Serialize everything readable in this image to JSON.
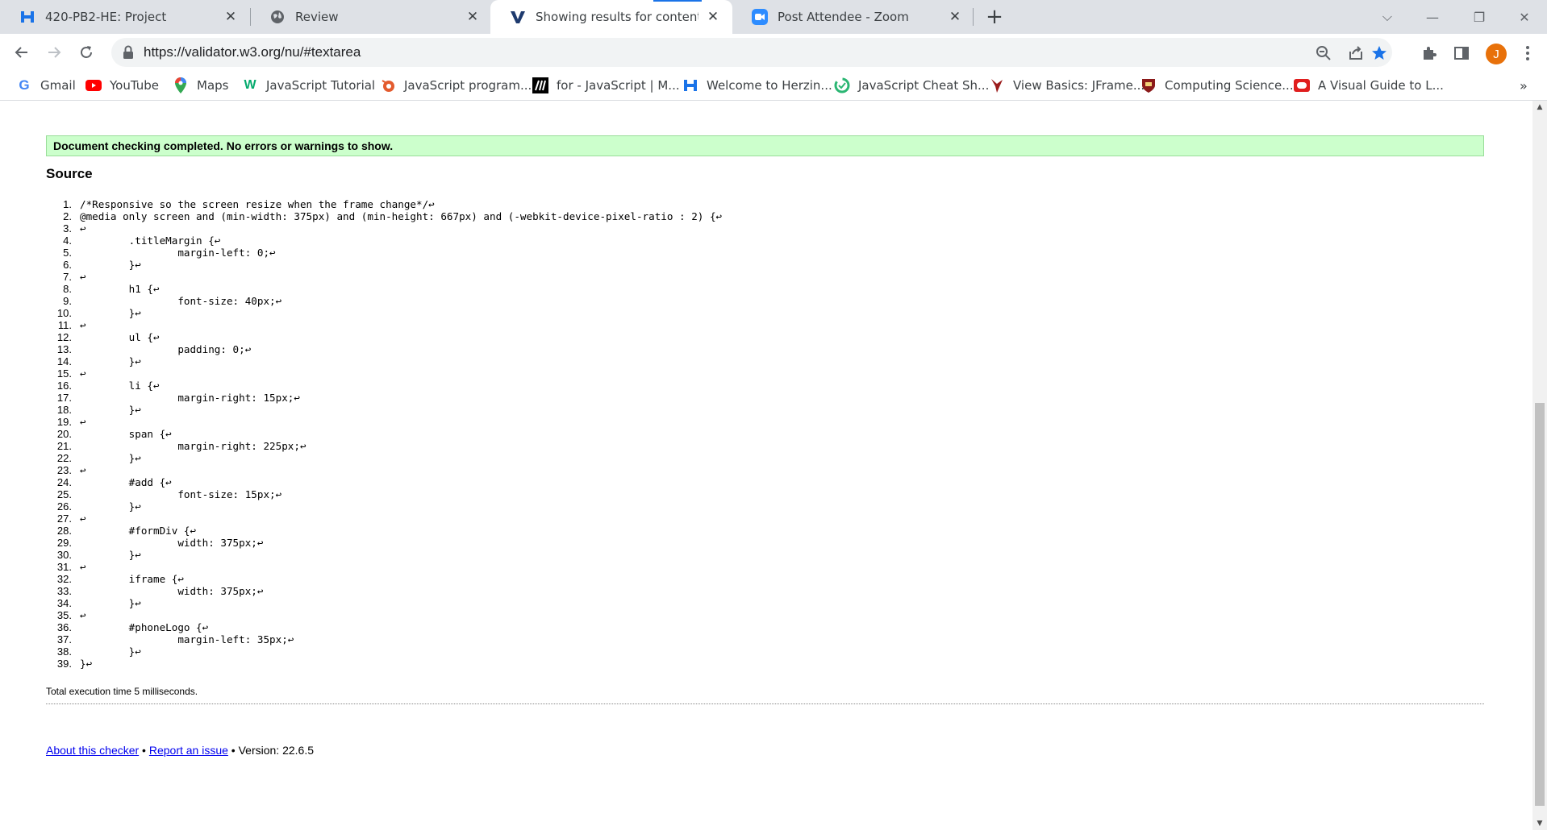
{
  "tabs": [
    {
      "title": "420-PB2-HE: Project",
      "icon": "h-logo-icon",
      "active": false
    },
    {
      "title": "Review",
      "icon": "globe-icon",
      "active": false
    },
    {
      "title": "Showing results for contents of te",
      "icon": "w3c-validator-icon",
      "active": true
    },
    {
      "title": "Post Attendee - Zoom",
      "icon": "zoom-icon",
      "active": false
    }
  ],
  "toolbar": {
    "url": "https://validator.w3.org/nu/#textarea",
    "avatar_letter": "J"
  },
  "bookmarks": [
    {
      "label": "Gmail",
      "icon": "google-icon"
    },
    {
      "label": "YouTube",
      "icon": "youtube-icon"
    },
    {
      "label": "Maps",
      "icon": "maps-icon"
    },
    {
      "label": "JavaScript Tutorial",
      "icon": "w3schools-icon"
    },
    {
      "label": "JavaScript program...",
      "icon": "programiz-icon"
    },
    {
      "label": "for - JavaScript | M...",
      "icon": "mdn-icon"
    },
    {
      "label": "Welcome to Herzin...",
      "icon": "h-logo-icon"
    },
    {
      "label": "JavaScript Cheat Sh...",
      "icon": "cheatsheet-icon"
    },
    {
      "label": "View Basics: JFrame...",
      "icon": "bird-icon"
    },
    {
      "label": "Computing Science...",
      "icon": "crest-icon"
    },
    {
      "label": "A Visual Guide to L...",
      "icon": "oracle-icon"
    }
  ],
  "page": {
    "status_message": "Document checking completed. No errors or warnings to show.",
    "source_heading": "Source",
    "source_lines": [
      "/*Responsive so the screen resize when the frame change*/↩",
      "@media only screen and (min-width: 375px) and (min-height: 667px) and (-webkit-device-pixel-ratio : 2) {↩",
      "↩",
      "        .titleMargin {↩",
      "                margin-left: 0;↩",
      "        }↩",
      "↩",
      "        h1 {↩",
      "                font-size: 40px;↩",
      "        }↩",
      "↩",
      "        ul {↩",
      "                padding: 0;↩",
      "        }↩",
      "↩",
      "        li {↩",
      "                margin-right: 15px;↩",
      "        }↩",
      "↩",
      "        span {↩",
      "                margin-right: 225px;↩",
      "        }↩",
      "↩",
      "        #add {↩",
      "                font-size: 15px;↩",
      "        }↩",
      "↩",
      "        #formDiv {↩",
      "                width: 375px;↩",
      "        }↩",
      "↩",
      "        iframe {↩",
      "                width: 375px;↩",
      "        }↩",
      "↩",
      "        #phoneLogo {↩",
      "                margin-left: 35px;↩",
      "        }↩",
      "}↩"
    ],
    "execution_time": "Total execution time 5 milliseconds.",
    "footer": {
      "about_link": "About this checker",
      "separator": " • ",
      "report_link": "Report an issue",
      "version": "Version: 22.6.5"
    }
  },
  "colors": {
    "success_bg": "#ccffcc",
    "link": "#0000ee",
    "tab_active_indicator": "#1a73e8",
    "avatar": "#e8710a"
  }
}
